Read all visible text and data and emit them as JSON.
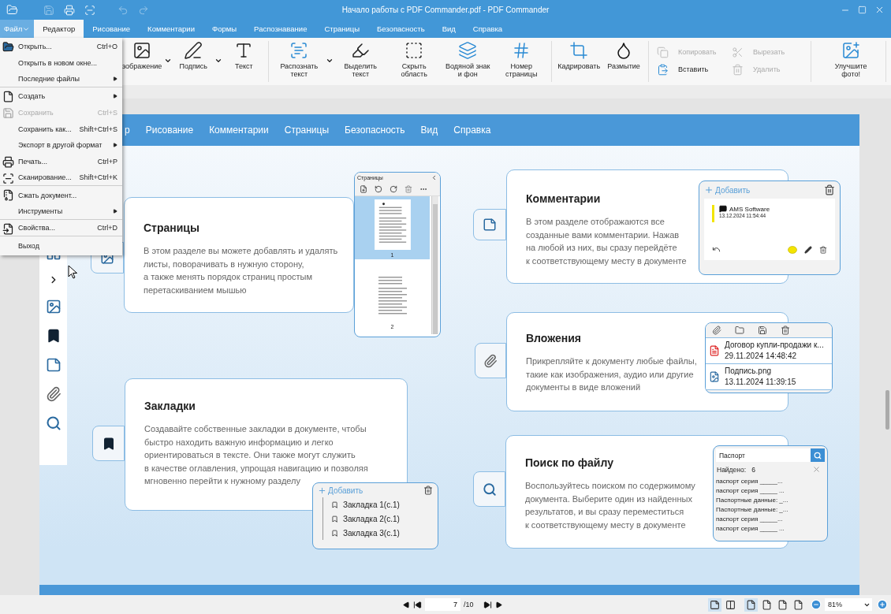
{
  "window": {
    "title": "Начало работы с PDF Commander.pdf - PDF Commander"
  },
  "tabs": [
    {
      "label": "Файл",
      "kind": "menu",
      "selected": false
    },
    {
      "label": "Редактор",
      "kind": "tab",
      "selected": true
    },
    {
      "label": "Рисование",
      "kind": "tab",
      "selected": false
    },
    {
      "label": "Комментарии",
      "kind": "tab",
      "selected": false
    },
    {
      "label": "Формы",
      "kind": "tab",
      "selected": false
    },
    {
      "label": "Распознавание",
      "kind": "tab",
      "selected": false
    },
    {
      "label": "Страницы",
      "kind": "tab",
      "selected": false
    },
    {
      "label": "Безопасность",
      "kind": "tab",
      "selected": false
    },
    {
      "label": "Вид",
      "kind": "tab",
      "selected": false
    },
    {
      "label": "Справка",
      "kind": "tab",
      "selected": false
    }
  ],
  "ribbon": [
    {
      "kind": "large",
      "items": [
        {
          "label": "зображение",
          "dropdown": true
        },
        {
          "label": "Подпись",
          "dropdown": true
        },
        {
          "label": "Текст",
          "dropdown": false
        }
      ]
    },
    {
      "kind": "large",
      "items": [
        {
          "label": "Распознать текст",
          "dropdown": true
        },
        {
          "label": "Выделить текст",
          "dropdown": false
        },
        {
          "label": "Скрыть область",
          "dropdown": false
        },
        {
          "label": "Водяной знак и фон",
          "dropdown": false
        },
        {
          "label": "Номер страницы",
          "dropdown": false
        }
      ]
    },
    {
      "kind": "large",
      "items": [
        {
          "label": "Кадрировать",
          "dropdown": false
        },
        {
          "label": "Размытие",
          "dropdown": false
        }
      ]
    },
    {
      "kind": "small",
      "items": [
        {
          "label": "Копировать",
          "disabled": true
        },
        {
          "label": "Вставить",
          "disabled": false
        },
        {
          "label": "Вырезать",
          "disabled": true
        },
        {
          "label": "Удалить",
          "disabled": true
        }
      ]
    },
    {
      "kind": "large",
      "items": [
        {
          "label": "Улучшите фото!",
          "dropdown": false
        }
      ]
    }
  ],
  "file_menu": [
    {
      "label": "Открыть...",
      "shortcut": "Ctrl+O",
      "submenu": false,
      "disabled": false,
      "separator_after": false
    },
    {
      "label": "Открыть в новом окне...",
      "submenu": false,
      "disabled": false,
      "separator_after": false
    },
    {
      "label": "Последние файлы",
      "submenu": true,
      "disabled": false,
      "separator_after": true
    },
    {
      "label": "Создать",
      "submenu": true,
      "disabled": false,
      "separator_after": false
    },
    {
      "label": "Сохранить",
      "shortcut": "Ctrl+S",
      "submenu": false,
      "disabled": true,
      "separator_after": false
    },
    {
      "label": "Сохранить как...",
      "shortcut": "Shift+Ctrl+S",
      "submenu": false,
      "disabled": false,
      "separator_after": false
    },
    {
      "label": "Экспорт в другой формат",
      "submenu": true,
      "disabled": false,
      "separator_after": false
    },
    {
      "label": "Печать...",
      "shortcut": "Ctrl+P",
      "submenu": false,
      "disabled": false,
      "separator_after": false
    },
    {
      "label": "Сканирование...",
      "shortcut": "Shift+Ctrl+K",
      "submenu": false,
      "disabled": false,
      "separator_after": true
    },
    {
      "label": "Сжать документ...",
      "submenu": false,
      "disabled": false,
      "separator_after": false
    },
    {
      "label": "Инструменты",
      "submenu": true,
      "disabled": false,
      "separator_after": true
    },
    {
      "label": "Свойства...",
      "shortcut": "Ctrl+D",
      "submenu": false,
      "disabled": false,
      "separator_after": true
    },
    {
      "label": "Выход",
      "submenu": false,
      "disabled": false,
      "separator_after": false
    }
  ],
  "page": {
    "nav": [
      "р",
      "Рисование",
      "Комментарии",
      "Страницы",
      "Безопасность",
      "Вид",
      "Справка"
    ],
    "pages_card": {
      "title": "Страницы",
      "text": "В этом разделе вы можете добавлять и удалять\nлисты, поворачивать в нужную сторону,\nа также менять порядок страниц простым\nперетаскиванием мышью",
      "panel": {
        "title": "Страницы",
        "thumbnails": [
          {
            "label": "1",
            "selected": true
          },
          {
            "label": "2",
            "selected": false
          }
        ]
      }
    },
    "comments_card": {
      "title": "Комментарии",
      "text": "В этом разделе отображаются все\nсозданные вами комментарии. Нажав\nна любой из них, вы сразу перейдёте\nк соответствующему месту в документе",
      "panel": {
        "add": "Добавить",
        "author": "AMS Software",
        "date": "13.12.2024 11:54:44"
      }
    },
    "attachments_card": {
      "title": "Вложения",
      "text": "Прикрепляйте к документу любые файлы,\nтакие как изображения, аудио или другие\nдокументы в виде вложений",
      "panel": {
        "files": [
          {
            "name": "Договор купли-продажи к...",
            "date": "29.11.2024 14:48:42",
            "kind": "pdf"
          },
          {
            "name": "Подпись.png",
            "date": "13.11.2024 11:39:15",
            "kind": "image"
          }
        ]
      }
    },
    "bookmarks_card": {
      "title": "Закладки",
      "text": "Создавайте собственные закладки в документе, чтобы\nбыстро находить важную информацию и легко\nориентироваться в тексте. Они также могут служить\nв качестве оглавления, упрощая навигацию и позволяя\nмгновенно перейти к нужному разделу",
      "panel": {
        "add": "Добавить",
        "items": [
          "Закладка 1(с.1)",
          "Закладка 2(с.1)",
          "Закладка 3(с.1)"
        ]
      }
    },
    "search_card": {
      "title": "Поиск по файлу",
      "text": "Воспользуйтесь поиском по содержимому\nдокумента. Выберите один из найденных\nрезультатов, и вы сразу переместиться\nк соответствующему месту в документе",
      "panel": {
        "query": "Паспорт",
        "found_label": "Найдено:",
        "found_count": "6",
        "results": [
          "паспорт серия _____...",
          "паспорт серия _____ ...",
          "Паспортные данные: _...",
          "Паспортные данные: _...",
          "паспорт серия _____...",
          "паспорт серия _____ ..."
        ]
      }
    }
  },
  "status_bar": {
    "page": "7",
    "total": "/10",
    "zoom": "81%",
    "layout_modes": [
      {
        "selected": true
      },
      {
        "selected": false
      }
    ],
    "page_modes": [
      {
        "selected": true
      },
      {
        "selected": false
      },
      {
        "selected": false
      },
      {
        "selected": false
      }
    ]
  }
}
